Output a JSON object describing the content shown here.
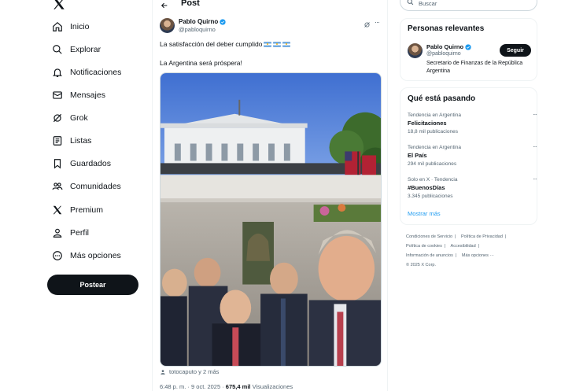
{
  "nav": {
    "items": [
      {
        "label": "Inicio",
        "icon": "home-icon"
      },
      {
        "label": "Explorar",
        "icon": "search-icon"
      },
      {
        "label": "Notificaciones",
        "icon": "bell-icon"
      },
      {
        "label": "Mensajes",
        "icon": "mail-icon"
      },
      {
        "label": "Grok",
        "icon": "grok-icon"
      },
      {
        "label": "Listas",
        "icon": "list-icon"
      },
      {
        "label": "Guardados",
        "icon": "bookmark-icon"
      },
      {
        "label": "Comunidades",
        "icon": "communities-icon"
      },
      {
        "label": "Premium",
        "icon": "x-premium-icon"
      },
      {
        "label": "Perfil",
        "icon": "person-icon"
      },
      {
        "label": "Más opciones",
        "icon": "more-circle-icon"
      }
    ],
    "post_button": "Postear"
  },
  "header": {
    "title": "Post"
  },
  "tweet": {
    "author_name": "Pablo Quirno",
    "author_handle": "@pabloquirno",
    "text_line1": "La satisfacción del deber cumplido",
    "text_line2": "La Argentina será próspera!",
    "tagged": "totocaputo y 2 más",
    "time": "6:48 p. m. · 9 oct. 2025 · ",
    "views_count": "675,4 mil",
    "views_label": " Visualizaciones"
  },
  "search": {
    "placeholder": "Buscar"
  },
  "relevant": {
    "title": "Personas relevantes",
    "name": "Pablo Quirno",
    "handle": "@pabloquirno",
    "follow_label": "Seguir",
    "bio": "Secretario de Finanzas de la República Argentina"
  },
  "trends": {
    "title": "Qué está pasando",
    "items": [
      {
        "context": "Tendencia en Argentina",
        "name": "Felicitaciones",
        "count": "18,8 mil publicaciones"
      },
      {
        "context": "Tendencia en Argentina",
        "name": "El País",
        "count": "294 mil publicaciones"
      },
      {
        "context": "Solo en X · Tendencia",
        "name": "#BuenosDías",
        "count": "3.345 publicaciones"
      }
    ],
    "show_more": "Mostrar más"
  },
  "footer": {
    "links": [
      "Condiciones de Servicio",
      "Política de Privacidad",
      "Política de cookies",
      "Accesibilidad",
      "Información de anuncios",
      "Más opciones ···"
    ],
    "copyright": "© 2025 X Corp."
  },
  "colors": {
    "accent": "#1d9bf0",
    "text": "#0f1419",
    "muted": "#536471",
    "button": "#0f1419"
  }
}
